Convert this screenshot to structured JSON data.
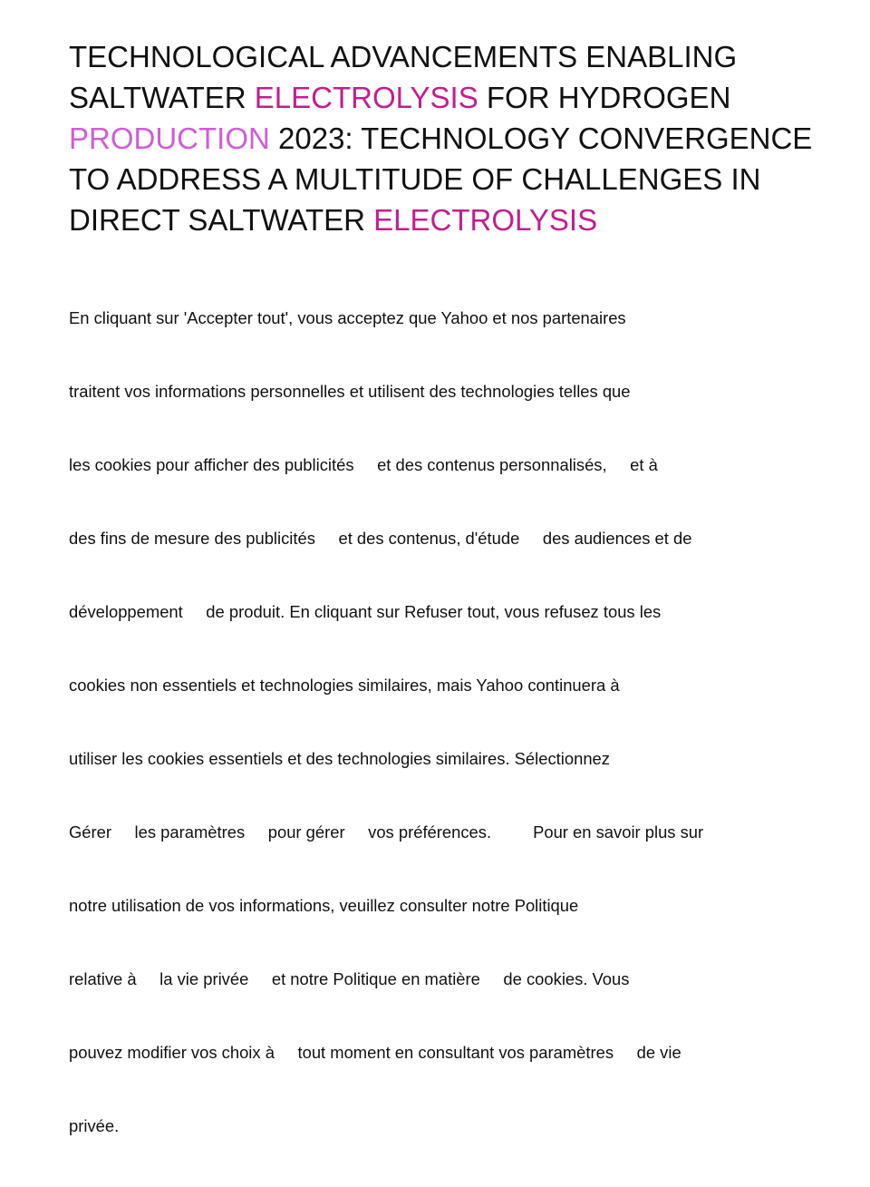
{
  "headline": {
    "parts": [
      {
        "text": "TECHNOLOGICAL ADVANCEMENTS ENABLING SALTWATER ",
        "color": "#111111"
      },
      {
        "text": "ELECTROLYSIS",
        "color": "#c21e8f"
      },
      {
        "text": " FOR HYDROGEN ",
        "color": "#111111"
      },
      {
        "text": "PRODUCTION",
        "color": "#d05cd8"
      },
      {
        "text": " 2023: TECHNOLOGY CONVERGENCE TO ADDRESS A MULTITUDE OF CHALLENGES IN DIRECT SALTWATER ",
        "color": "#111111"
      },
      {
        "text": "ELECTROLYSIS",
        "color": "#c21e8f"
      }
    ]
  },
  "consent": {
    "lines": [
      "En cliquant sur 'Accepter tout', vous acceptez que Yahoo et nos partenaires",
      "traitent vos informations personnelles et utilisent des technologies telles que",
      "les cookies pour afficher des publicités     et des contenus personnalisés,     et à",
      "des fins de mesure des publicités     et des contenus, d'étude     des audiences et de",
      "développement     de produit. En cliquant sur Refuser tout, vous refusez tous les",
      "cookies non essentiels et technologies similaires, mais Yahoo continuera à",
      "utiliser les cookies essentiels et des technologies similaires. Sélectionnez",
      "Gérer     les paramètres     pour gérer     vos préférences.         Pour en savoir plus sur",
      "notre utilisation de vos informations, veuillez consulter notre Politique",
      "relative à     la vie privée     et notre Politique en matière     de cookies. Vous",
      "pouvez modifier vos choix à     tout moment en consultant vos paramètres     de vie",
      "privée."
    ]
  }
}
